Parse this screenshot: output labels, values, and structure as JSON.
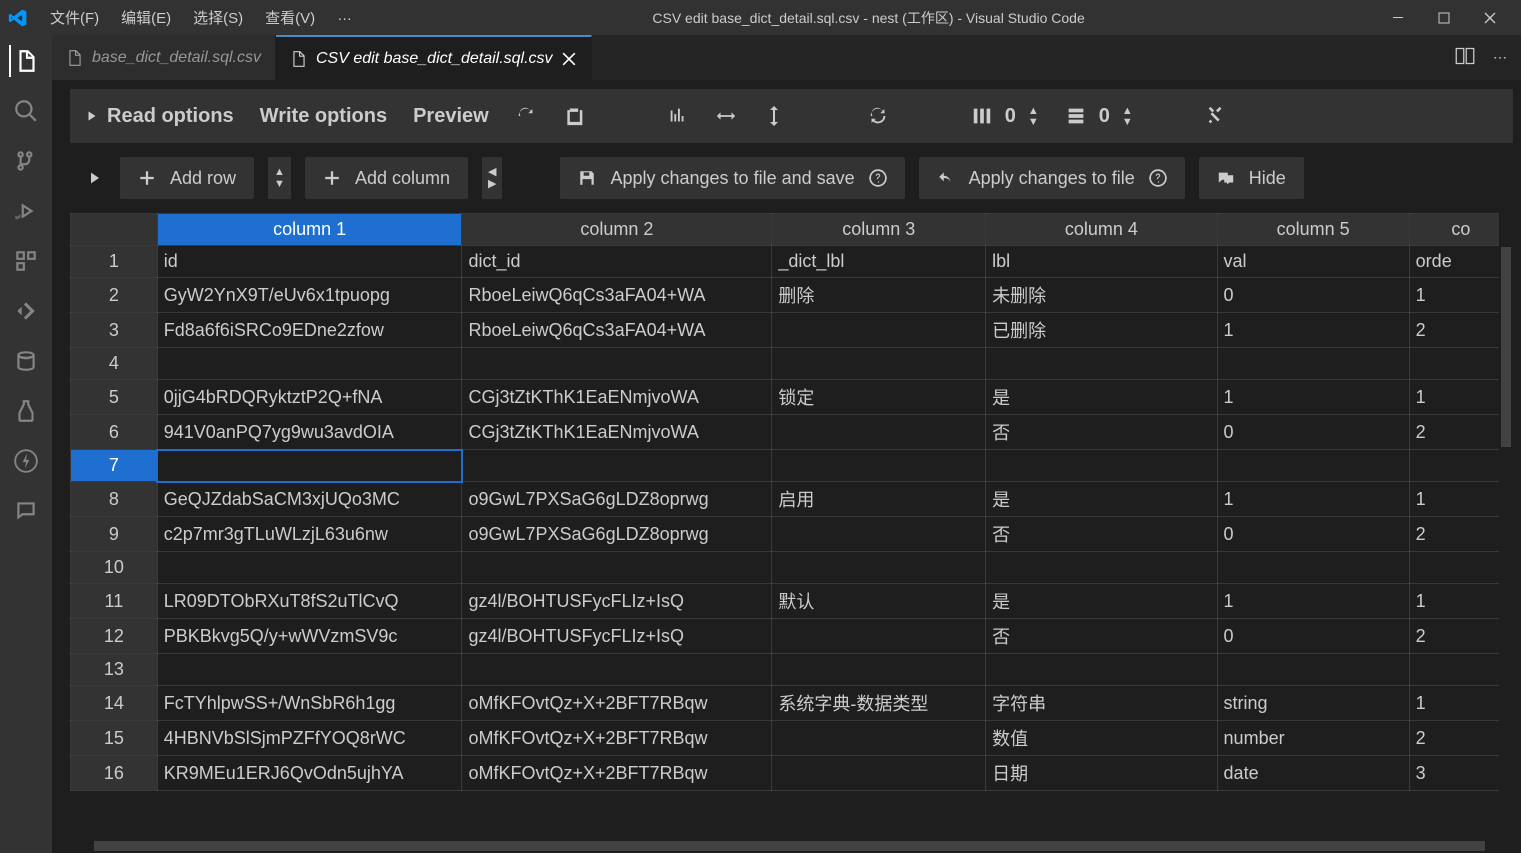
{
  "window": {
    "title": "CSV edit base_dict_detail.sql.csv - nest (工作区) - Visual Studio Code",
    "menus": [
      "文件(F)",
      "编辑(E)",
      "选择(S)",
      "查看(V)",
      "…"
    ]
  },
  "tabs": [
    {
      "label": "base_dict_detail.sql.csv",
      "active": false
    },
    {
      "label": "CSV edit base_dict_detail.sql.csv",
      "active": true
    }
  ],
  "toolbar1": {
    "read_options": "Read options",
    "write_options": "Write options",
    "preview": "Preview",
    "num1": "0",
    "num2": "0"
  },
  "toolbar2": {
    "add_row": "Add row",
    "add_column": "Add column",
    "apply_save": "Apply changes to file and save",
    "apply": "Apply changes to file",
    "hide": "Hide"
  },
  "table": {
    "headers": [
      "column 1",
      "column 2",
      "column 3",
      "column 4",
      "column 5",
      "co"
    ],
    "rows": [
      {
        "n": "1",
        "c": [
          "id",
          "dict_id",
          "_dict_lbl",
          "lbl",
          "val",
          "orde"
        ]
      },
      {
        "n": "2",
        "c": [
          "GyW2YnX9T/eUv6x1tpuopg",
          "RboeLeiwQ6qCs3aFA04+WA",
          "删除",
          "未删除",
          "0",
          "1"
        ]
      },
      {
        "n": "3",
        "c": [
          "Fd8a6f6iSRCo9EDne2zfow",
          "RboeLeiwQ6qCs3aFA04+WA",
          "",
          "已删除",
          "1",
          "2"
        ]
      },
      {
        "n": "4",
        "c": [
          "",
          "",
          "",
          "",
          "",
          ""
        ]
      },
      {
        "n": "5",
        "c": [
          "0jjG4bRDQRyktztP2Q+fNA",
          "CGj3tZtKThK1EaENmjvoWA",
          "锁定",
          "是",
          "1",
          "1"
        ]
      },
      {
        "n": "6",
        "c": [
          "941V0anPQ7yg9wu3avdOIA",
          "CGj3tZtKThK1EaENmjvoWA",
          "",
          "否",
          "0",
          "2"
        ]
      },
      {
        "n": "7",
        "c": [
          "",
          "",
          "",
          "",
          "",
          ""
        ],
        "active": true
      },
      {
        "n": "8",
        "c": [
          "GeQJZdabSaCM3xjUQo3MC",
          "o9GwL7PXSaG6gLDZ8oprwg",
          "启用",
          "是",
          "1",
          "1"
        ]
      },
      {
        "n": "9",
        "c": [
          "c2p7mr3gTLuWLzjL63u6nw",
          "o9GwL7PXSaG6gLDZ8oprwg",
          "",
          "否",
          "0",
          "2"
        ]
      },
      {
        "n": "10",
        "c": [
          "",
          "",
          "",
          "",
          "",
          ""
        ]
      },
      {
        "n": "11",
        "c": [
          "LR09DTObRXuT8fS2uTlCvQ",
          "gz4l/BOHTUSFycFLIz+IsQ",
          "默认",
          "是",
          "1",
          "1"
        ]
      },
      {
        "n": "12",
        "c": [
          "PBKBkvg5Q/y+wWVzmSV9c",
          "gz4l/BOHTUSFycFLIz+IsQ",
          "",
          "否",
          "0",
          "2"
        ]
      },
      {
        "n": "13",
        "c": [
          "",
          "",
          "",
          "",
          "",
          ""
        ]
      },
      {
        "n": "14",
        "c": [
          "FcTYhlpwSS+/WnSbR6h1gg",
          "oMfKFOvtQz+X+2BFT7RBqw",
          "系统字典-数据类型",
          "字符串",
          "string",
          "1"
        ]
      },
      {
        "n": "15",
        "c": [
          "4HBNVbSlSjmPZFfYOQ8rWC",
          "oMfKFOvtQz+X+2BFT7RBqw",
          "",
          "数值",
          "number",
          "2"
        ]
      },
      {
        "n": "16",
        "c": [
          "KR9MEu1ERJ6QvOdn5ujhYA",
          "oMfKFOvtQz+X+2BFT7RBqw",
          "",
          "日期",
          "date",
          "3"
        ]
      }
    ]
  }
}
